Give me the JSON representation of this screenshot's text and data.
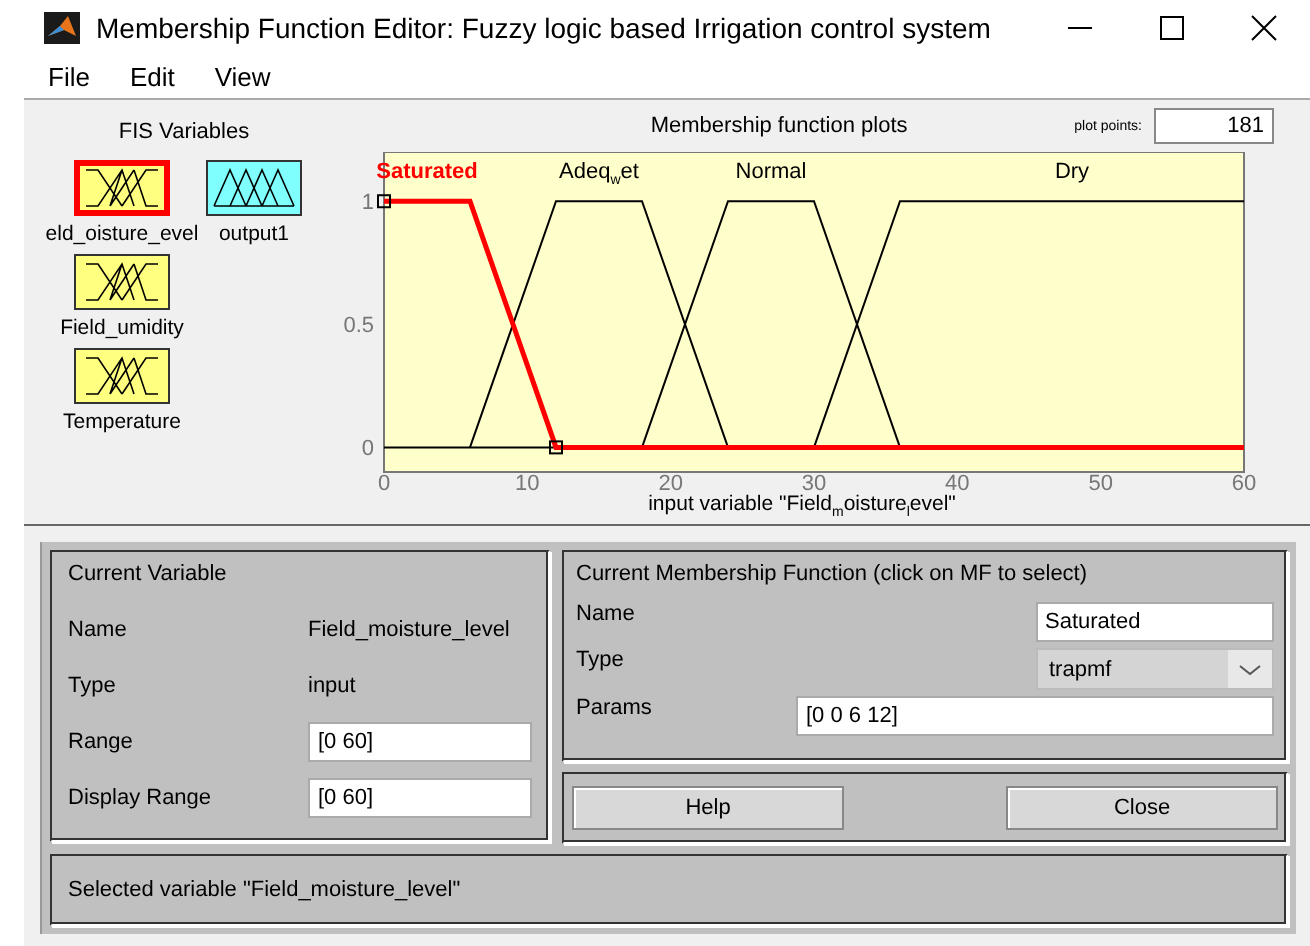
{
  "window": {
    "title": "Membership Function Editor: Fuzzy logic based Irrigation control system"
  },
  "menu": [
    "File",
    "Edit",
    "View"
  ],
  "fis_variables": {
    "title": "FIS Variables",
    "items": [
      {
        "label": "eld_oisture_evel",
        "kind": "input",
        "selected": true
      },
      {
        "label": "output1",
        "kind": "output",
        "selected": false
      },
      {
        "label": "Field_umidity",
        "kind": "input",
        "selected": false
      },
      {
        "label": "Temperature",
        "kind": "input",
        "selected": false
      }
    ]
  },
  "plot": {
    "title": "Membership function plots",
    "plot_points_label": "plot points:",
    "plot_points": "181",
    "chart_data": {
      "type": "line",
      "xlabel": "input variable \"Field$_{m}$oisture$_{l}$evel\"",
      "x": [
        0,
        6,
        12,
        18,
        24,
        30,
        36,
        60
      ],
      "xlim": [
        0,
        60
      ],
      "ylim": [
        -0.1,
        1.2
      ],
      "xticks": [
        0,
        10,
        20,
        30,
        40,
        50,
        60
      ],
      "yticks": [
        0,
        0.5,
        1
      ],
      "series": [
        {
          "name": "Saturated",
          "color": "#ff0000",
          "values": [
            1,
            1,
            0,
            0,
            0,
            0,
            0,
            0
          ]
        },
        {
          "name": "Adeq$_{w}$et",
          "color": "#000000",
          "values": [
            null,
            0,
            1,
            1,
            0,
            null,
            null,
            null
          ]
        },
        {
          "name": "Normal",
          "color": "#000000",
          "values": [
            null,
            null,
            null,
            0,
            1,
            1,
            0,
            null
          ]
        },
        {
          "name": "Dry",
          "color": "#000000",
          "values": [
            null,
            null,
            null,
            null,
            null,
            0,
            1,
            1
          ]
        }
      ]
    }
  },
  "current_variable": {
    "title": "Current Variable",
    "rows": [
      {
        "label": "Name",
        "value": "Field_moisture_level",
        "kind": "text"
      },
      {
        "label": "Type",
        "value": "input",
        "kind": "text"
      },
      {
        "label": "Range",
        "value": "[0 60]",
        "kind": "field"
      },
      {
        "label": "Display Range",
        "value": "[0 60]",
        "kind": "field"
      }
    ]
  },
  "current_mf": {
    "title": "Current Membership Function (click on MF to select)",
    "name": {
      "label": "Name",
      "value": "Saturated"
    },
    "type": {
      "label": "Type",
      "value": "trapmf"
    },
    "params": {
      "label": "Params",
      "value": "[0 0 6 12]"
    }
  },
  "buttons": [
    "Help",
    "Close"
  ],
  "status": "Selected variable \"Field_moisture_level\""
}
